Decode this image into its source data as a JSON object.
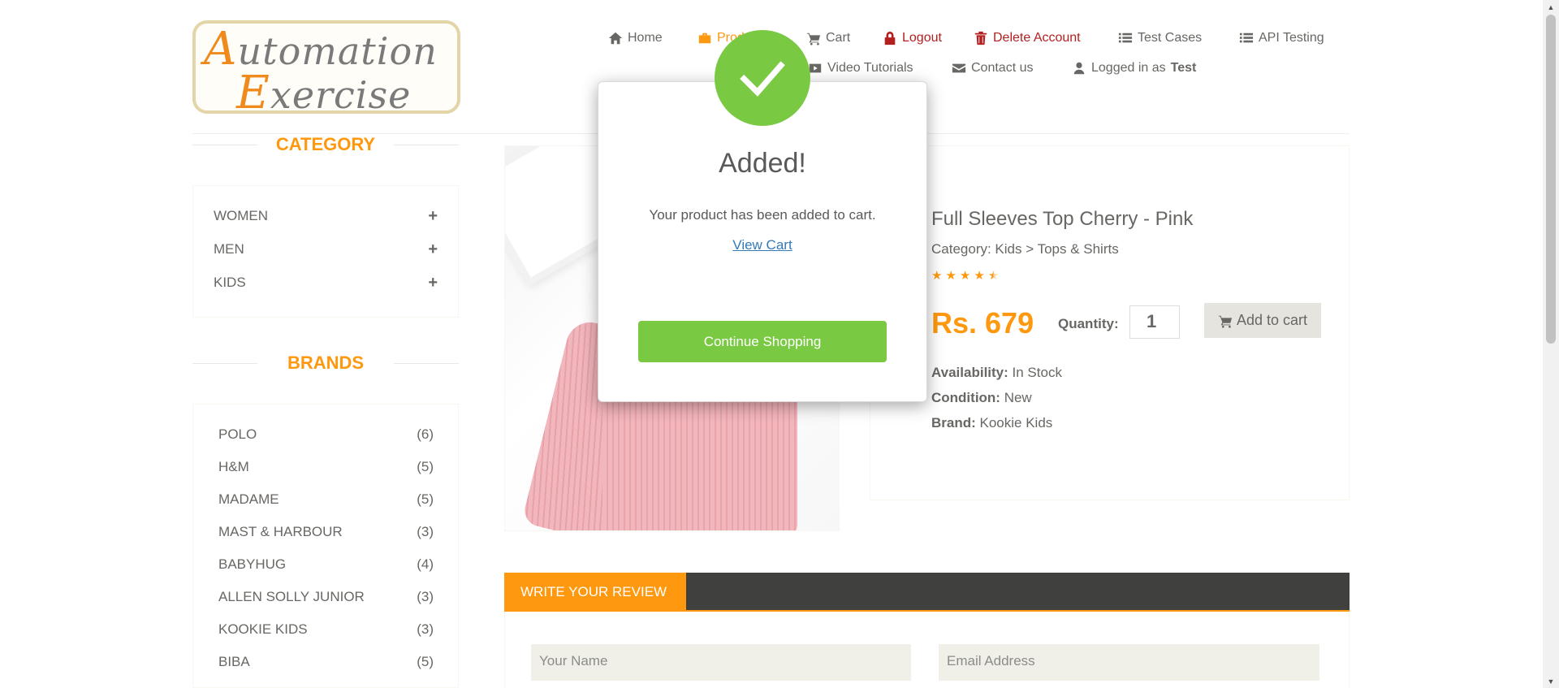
{
  "logo": {
    "line1": "Automation",
    "line2": "Exercise"
  },
  "nav": {
    "home": "Home",
    "products": "Products",
    "cart": "Cart",
    "logout": "Logout",
    "delete_account": "Delete Account",
    "test_cases": "Test Cases",
    "api_testing": "API Testing",
    "video_tutorials": "Video Tutorials",
    "contact_us": "Contact us",
    "logged_in_prefix": "Logged in as",
    "logged_in_user": "Test"
  },
  "sidebar": {
    "category_title": "CATEGORY",
    "categories": [
      "WOMEN",
      "MEN",
      "KIDS"
    ],
    "brands_title": "BRANDS",
    "brands": [
      {
        "name": "POLO",
        "count": "(6)"
      },
      {
        "name": "H&M",
        "count": "(5)"
      },
      {
        "name": "MADAME",
        "count": "(5)"
      },
      {
        "name": "MAST & HARBOUR",
        "count": "(3)"
      },
      {
        "name": "BABYHUG",
        "count": "(4)"
      },
      {
        "name": "ALLEN SOLLY JUNIOR",
        "count": "(3)"
      },
      {
        "name": "KOOKIE KIDS",
        "count": "(3)"
      },
      {
        "name": "BIBA",
        "count": "(5)"
      }
    ]
  },
  "product": {
    "name": "Full Sleeves Top Cherry - Pink",
    "category": "Category: Kids > Tops & Shirts",
    "rating": 4.5,
    "price": "Rs. 679",
    "quantity_label": "Quantity:",
    "quantity_value": "1",
    "add_to_cart": "Add to cart",
    "availability_label": "Availability:",
    "availability_value": "In Stock",
    "condition_label": "Condition:",
    "condition_value": "New",
    "brand_label": "Brand:",
    "brand_value": "Kookie Kids"
  },
  "review": {
    "tab_label": "WRITE YOUR REVIEW",
    "name_placeholder": "Your Name",
    "email_placeholder": "Email Address"
  },
  "modal": {
    "title": "Added!",
    "message": "Your product has been added to cart.",
    "view_cart": "View Cart",
    "continue": "Continue Shopping"
  },
  "colors": {
    "accent": "#fe980f",
    "success": "#7ac943",
    "danger": "#b41f1f",
    "text": "#696763",
    "dark_bar": "#40403e"
  }
}
